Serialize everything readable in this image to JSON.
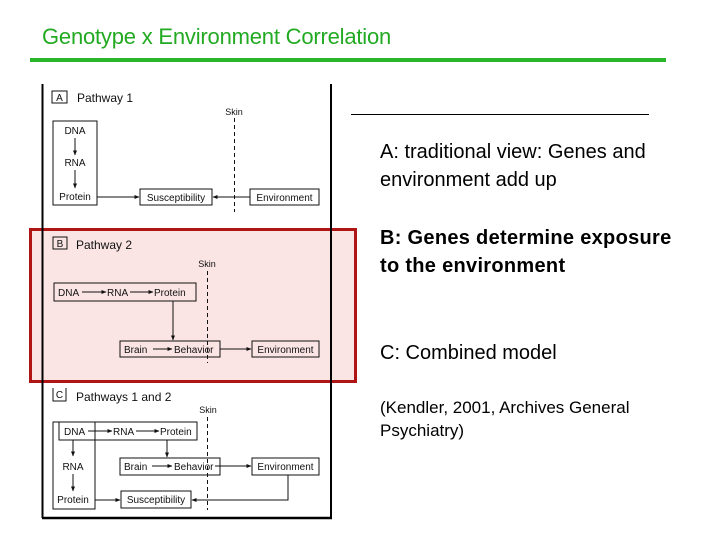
{
  "slide": {
    "title": "Genotype x Environment Correlation",
    "accent_color": "#2bb52b",
    "highlight_color": "#b01515"
  },
  "figure": {
    "panels": [
      {
        "letter": "A",
        "heading": "Pathway 1",
        "skin_label": "Skin",
        "nodes": {
          "dna": "DNA",
          "rna": "RNA",
          "protein": "Protein",
          "susceptibility": "Susceptibility",
          "environment": "Environment"
        }
      },
      {
        "letter": "B",
        "heading": "Pathway 2",
        "skin_label": "Skin",
        "highlighted": true,
        "nodes": {
          "dna": "DNA",
          "rna": "RNA",
          "protein": "Protein",
          "brain": "Brain",
          "behavior": "Behavior",
          "environment": "Environment"
        }
      },
      {
        "letter": "C",
        "heading": "Pathways 1 and 2",
        "skin_label": "Skin",
        "nodes": {
          "dna": "DNA",
          "rna_h": "RNA",
          "protein_h": "Protein",
          "rna_v": "RNA",
          "protein_v": "Protein",
          "brain": "Brain",
          "behavior": "Behavior",
          "environment": "Environment",
          "susceptibility": "Susceptibility"
        }
      }
    ]
  },
  "captions": {
    "a": "A: traditional view: Genes and environment add up",
    "b": "B: Genes determine exposure to the environment",
    "c": "C: Combined model",
    "reference": "(Kendler, 2001, Archives General Psychiatry)"
  }
}
